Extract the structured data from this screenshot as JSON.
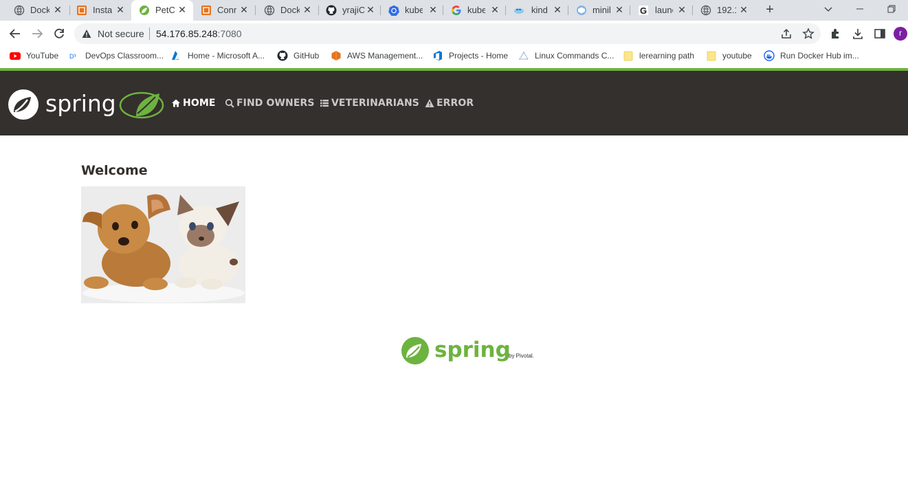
{
  "browser": {
    "tabs": [
      {
        "title": "Dock",
        "icon": "globe-icon"
      },
      {
        "title": "Insta",
        "icon": "aws-icon"
      },
      {
        "title": "PetCl",
        "icon": "spring-leaf-icon",
        "active": true
      },
      {
        "title": "Conn",
        "icon": "aws-icon"
      },
      {
        "title": "Dock",
        "icon": "globe-icon"
      },
      {
        "title": "yrajiC",
        "icon": "github-icon"
      },
      {
        "title": "kube",
        "icon": "kubernetes-icon"
      },
      {
        "title": "kube",
        "icon": "google-icon"
      },
      {
        "title": "kind",
        "icon": "kind-icon"
      },
      {
        "title": "minik",
        "icon": "minikube-icon"
      },
      {
        "title": "launc",
        "icon": "google-g-icon"
      },
      {
        "title": "192.1",
        "icon": "globe-icon"
      }
    ],
    "new_tab": "+",
    "address": {
      "security_label": "Not secure",
      "host": "54.176.85.248",
      "port": ":7080"
    },
    "profile_initial": "r",
    "bookmarks": [
      {
        "label": "YouTube",
        "icon": "youtube-icon"
      },
      {
        "label": "DevOps Classroom...",
        "icon": "devops-icon"
      },
      {
        "label": "Home - Microsoft A...",
        "icon": "azure-icon"
      },
      {
        "label": "GitHub",
        "icon": "github-icon"
      },
      {
        "label": "AWS Management...",
        "icon": "aws-icon"
      },
      {
        "label": "Projects - Home",
        "icon": "azure-devops-icon"
      },
      {
        "label": "Linux Commands C...",
        "icon": "linux-icon"
      },
      {
        "label": "lerearning path",
        "icon": "folder-icon"
      },
      {
        "label": "youtube",
        "icon": "folder-icon"
      },
      {
        "label": "Run Docker Hub im...",
        "icon": "docker-icon"
      }
    ]
  },
  "page": {
    "nav": [
      {
        "label": "HOME",
        "icon": "home-icon",
        "active": true
      },
      {
        "label": "FIND OWNERS",
        "icon": "search-icon"
      },
      {
        "label": "VETERINARIANS",
        "icon": "list-icon"
      },
      {
        "label": "ERROR",
        "icon": "warning-icon"
      }
    ],
    "heading": "Welcome",
    "brand_word": "spring",
    "footer_word": "spring",
    "footer_by": "by Pivotal.",
    "colors": {
      "navbar": "#34302d",
      "accent": "#6db33f"
    }
  }
}
